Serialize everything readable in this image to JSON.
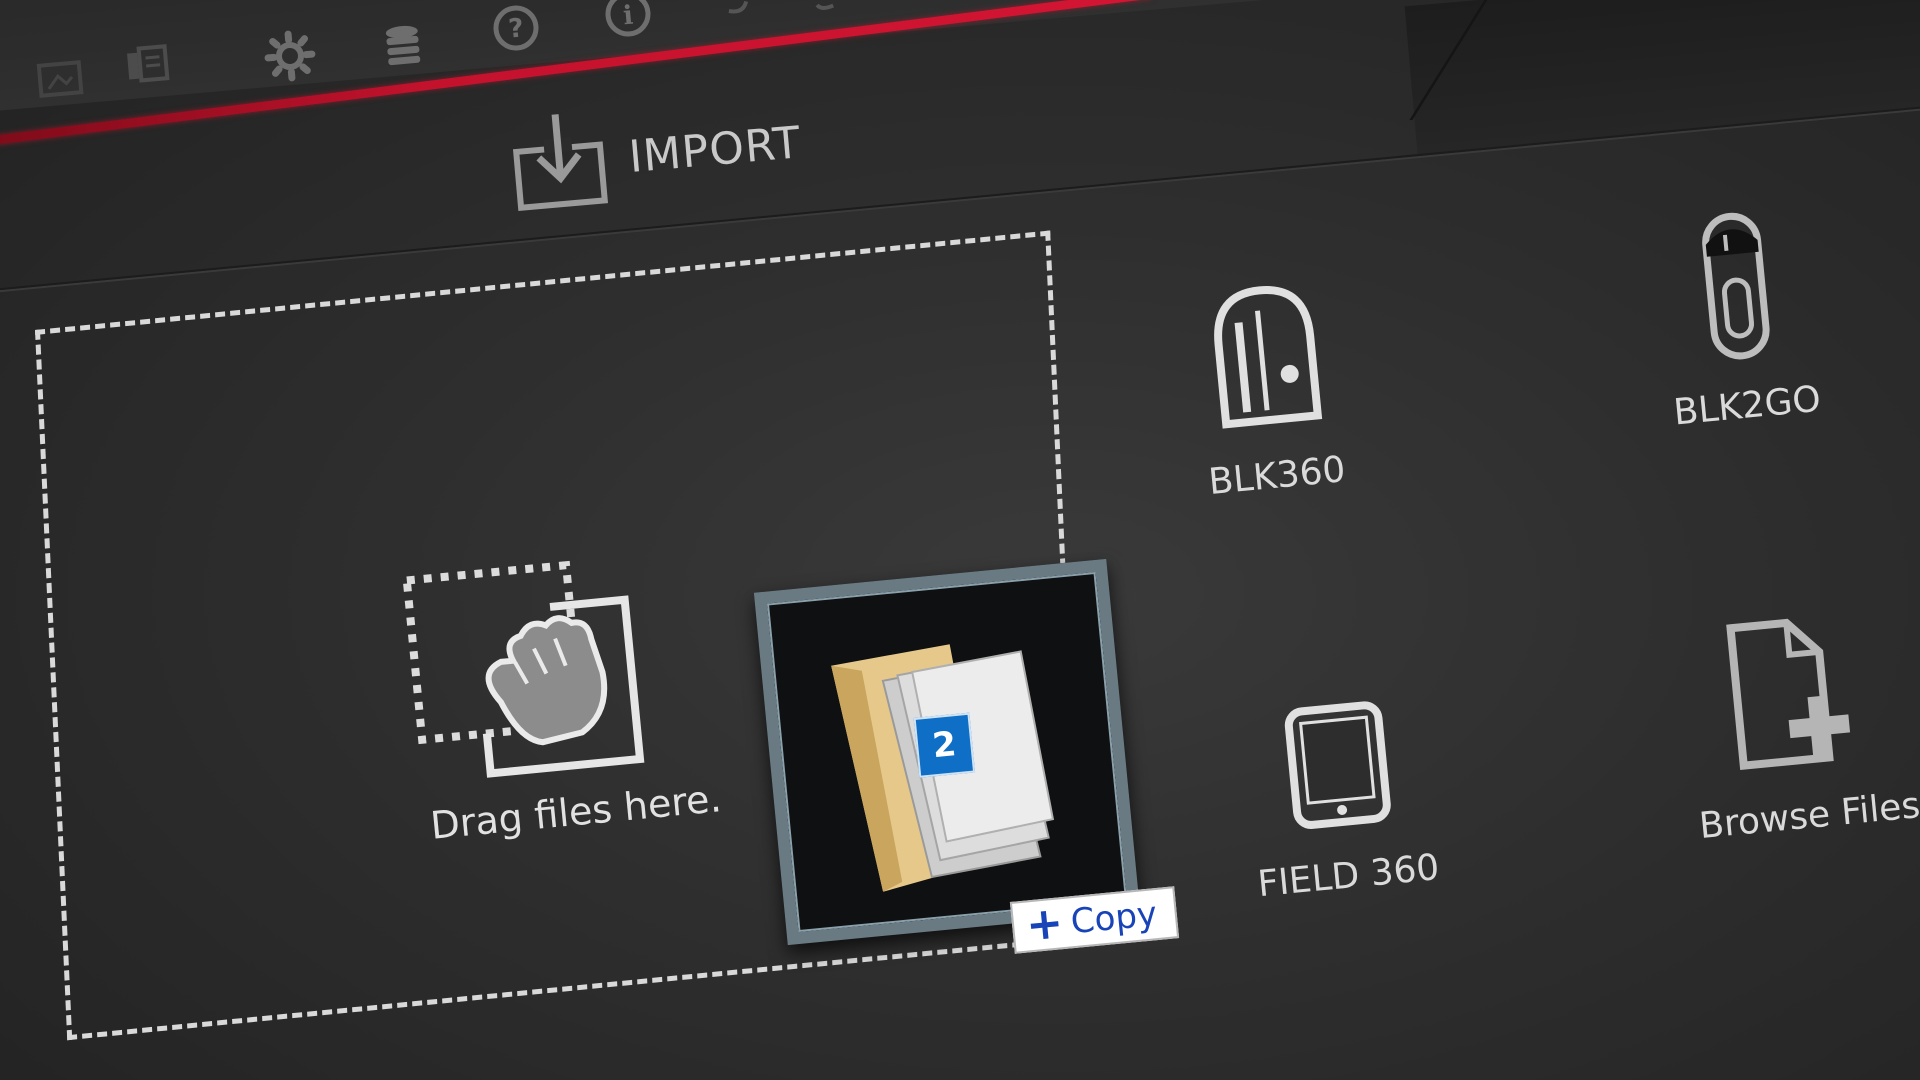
{
  "toolbar": {
    "icons": [
      "image-icon",
      "slides-icon",
      "gear-icon",
      "database-icon",
      "help-icon",
      "info-icon",
      "undo-icon",
      "redo-icon"
    ],
    "accent_color": "#c4122d"
  },
  "import_tab": {
    "label": "IMPORT",
    "icon": "import-tray-icon"
  },
  "drop_zone": {
    "label": "Drag files here.",
    "icon": "drag-hand-icon"
  },
  "drag_preview": {
    "count": "2",
    "tooltip_label": "Copy",
    "tooltip_color": "#1944b8"
  },
  "options": [
    {
      "id": "blk360",
      "label": "BLK360",
      "icon": "blk360-scanner-icon"
    },
    {
      "id": "blk2go",
      "label": "BLK2GO",
      "icon": "blk2go-scanner-icon"
    },
    {
      "id": "field360",
      "label": "FIELD 360",
      "icon": "tablet-icon"
    },
    {
      "id": "browse",
      "label": "Browse Files",
      "icon": "file-add-icon"
    }
  ]
}
